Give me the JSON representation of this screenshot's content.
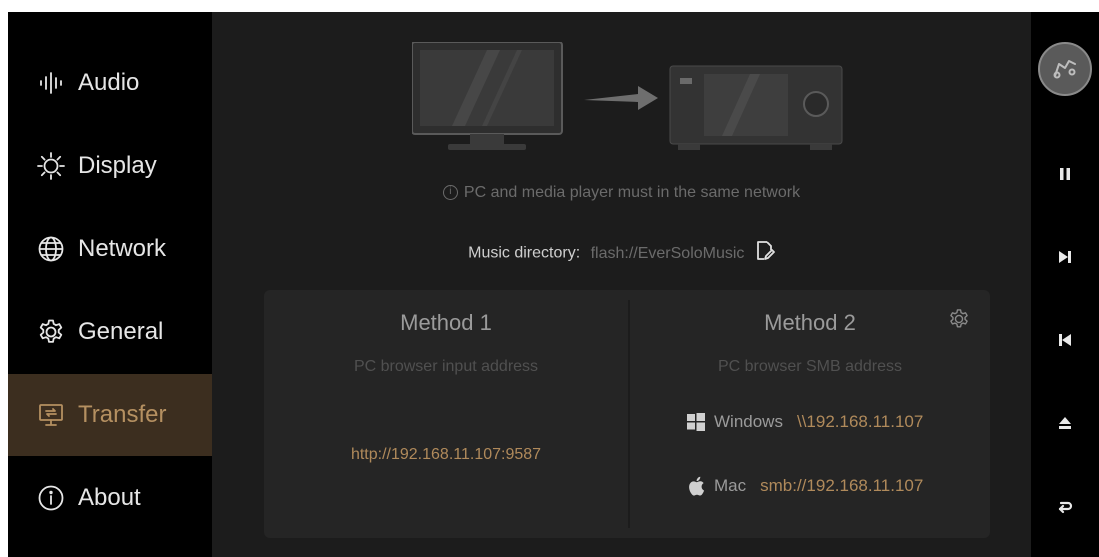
{
  "sidebar": {
    "items": [
      {
        "label": "Audio",
        "icon": "audio-waveform-icon",
        "active": false
      },
      {
        "label": "Display",
        "icon": "brightness-icon",
        "active": false
      },
      {
        "label": "Network",
        "icon": "globe-icon",
        "active": false
      },
      {
        "label": "General",
        "icon": "gear-icon",
        "active": false
      },
      {
        "label": "Transfer",
        "icon": "monitor-transfer-icon",
        "active": true
      },
      {
        "label": "About",
        "icon": "info-icon",
        "active": false
      }
    ]
  },
  "main": {
    "notice": "PC and media player must in the same network",
    "music_directory": {
      "label": "Music directory:",
      "value": "flash://EverSoloMusic"
    },
    "method1": {
      "title": "Method 1",
      "subtitle": "PC browser input address",
      "url": "http://192.168.11.107:9587"
    },
    "method2": {
      "title": "Method 2",
      "subtitle": "PC browser SMB address",
      "windows": {
        "name": "Windows",
        "address": "\\\\192.168.11.107"
      },
      "mac": {
        "name": "Mac",
        "address": "smb://192.168.11.107"
      }
    }
  },
  "controls": [
    "album-art",
    "pause-icon",
    "next-track-icon",
    "previous-track-icon",
    "eject-icon",
    "back-icon"
  ],
  "colors": {
    "accent": "#b08a5b",
    "active_bg": "#3c2e1f",
    "panel_bg": "#252525",
    "main_bg": "#1c1c1c"
  }
}
